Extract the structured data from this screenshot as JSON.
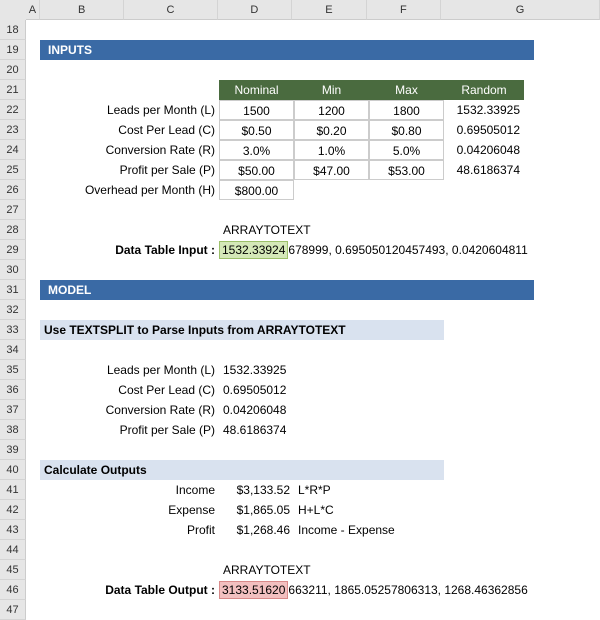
{
  "columns": [
    "A",
    "B",
    "C",
    "D",
    "E",
    "F",
    "G"
  ],
  "col_widths": {
    "A": 14,
    "B": 85,
    "C": 94,
    "D": 75,
    "E": 75,
    "F": 75,
    "G": 160
  },
  "rows": [
    18,
    19,
    20,
    21,
    22,
    23,
    24,
    25,
    26,
    27,
    28,
    29,
    30,
    31,
    32,
    33,
    34,
    35,
    36,
    37,
    38,
    39,
    40,
    41,
    42,
    43,
    44,
    45,
    46,
    47
  ],
  "sections": {
    "inputs_title": "INPUTS",
    "model_title": "MODEL",
    "parse_title": "Use TEXTSPLIT to Parse Inputs from ARRAYTOTEXT",
    "calc_title": "Calculate Outputs"
  },
  "input_headers": {
    "nominal": "Nominal",
    "min": "Min",
    "max": "Max",
    "random": "Random"
  },
  "input_rows": [
    {
      "label": "Leads per Month (L)",
      "nominal": "1500",
      "min": "1200",
      "max": "1800",
      "random": "1532.33925"
    },
    {
      "label": "Cost Per Lead (C)",
      "nominal": "$0.50",
      "min": "$0.20",
      "max": "$0.80",
      "random": "0.69505012"
    },
    {
      "label": "Conversion Rate (R)",
      "nominal": "3.0%",
      "min": "1.0%",
      "max": "5.0%",
      "random": "0.04206048"
    },
    {
      "label": "Profit per Sale (P)",
      "nominal": "$50.00",
      "min": "$47.00",
      "max": "$53.00",
      "random": "48.6186374"
    },
    {
      "label": "Overhead per Month (H)",
      "nominal": "$800.00",
      "min": "",
      "max": "",
      "random": ""
    }
  ],
  "array_label": "ARRAYTOTEXT",
  "data_table_input_label": "Data Table Input :",
  "data_table_input_hl": "1532.33924",
  "data_table_input_rest": "678999, 0.695050120457493, 0.0420604811",
  "parsed_rows": [
    {
      "label": "Leads per Month (L)",
      "value": "1532.33925"
    },
    {
      "label": "Cost Per Lead (C)",
      "value": "0.69505012"
    },
    {
      "label": "Conversion Rate (R)",
      "value": "0.04206048"
    },
    {
      "label": "Profit per Sale (P)",
      "value": "48.6186374"
    }
  ],
  "output_rows": [
    {
      "label": "Income",
      "value": "$3,133.52",
      "formula": "L*R*P"
    },
    {
      "label": "Expense",
      "value": "$1,865.05",
      "formula": "H+L*C"
    },
    {
      "label": "Profit",
      "value": "$1,268.46",
      "formula": "Income - Expense"
    }
  ],
  "data_table_output_label": "Data Table Output :",
  "data_table_output_hl": "3133.51620",
  "data_table_output_rest": "663211, 1865.05257806313, 1268.46362856",
  "chart_data": null
}
